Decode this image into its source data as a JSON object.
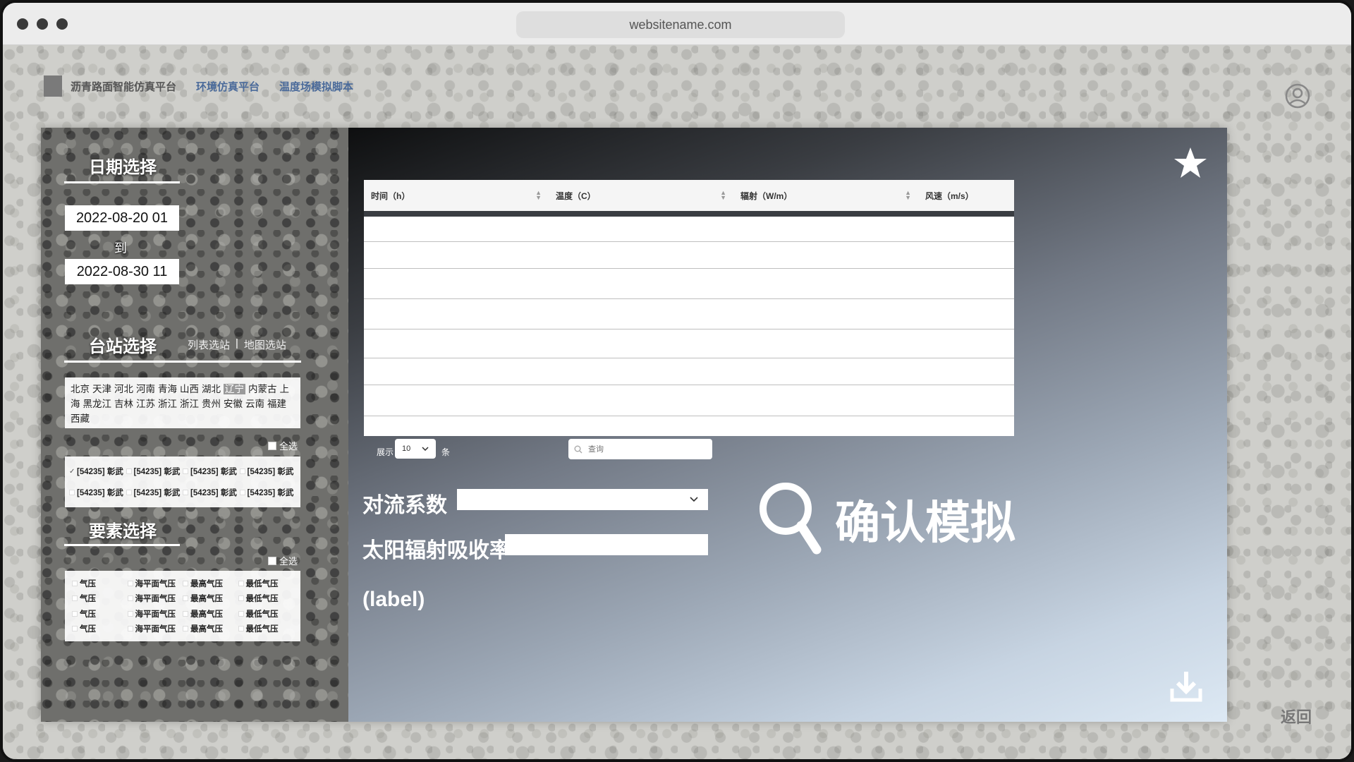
{
  "browser": {
    "url": "websitename.com"
  },
  "nav": {
    "title": "沥青路面智能仿真平台",
    "link1": "环境仿真平台",
    "link2": "温度场模拟脚本"
  },
  "date": {
    "title": "日期选择",
    "start": "2022-08-20 01",
    "to": "到",
    "end": "2022-08-30 11"
  },
  "station": {
    "title": "台站选择",
    "tab_list": "列表选站",
    "tab_map": "地图选站",
    "separator": "|",
    "provinces": [
      "北京",
      "天津",
      "河北",
      "河南",
      "青海",
      "山西",
      "湖北",
      "辽宁",
      "内蒙古",
      "上海",
      "黑龙江",
      "吉林",
      "江苏",
      "浙江",
      "浙江",
      "贵州",
      "安徽",
      "云南",
      "福建",
      "西藏"
    ],
    "selected_province": "辽宁",
    "select_all": "全选",
    "items": [
      "[54235] 彰武",
      "[54235] 彰武",
      "[54235] 彰武",
      "[54235] 彰武",
      "[54235] 彰武",
      "[54235] 彰武",
      "[54235] 彰武",
      "[54235] 彰武"
    ]
  },
  "elements": {
    "title": "要素选择",
    "select_all": "全选",
    "items": [
      "气压",
      "海平面气压",
      "最高气压",
      "最低气压",
      "气压",
      "海平面气压",
      "最高气压",
      "最低气压",
      "气压",
      "海平面气压",
      "最高气压",
      "最低气压",
      "气压",
      "海平面气压",
      "最高气压",
      "最低气压"
    ]
  },
  "table": {
    "headers": [
      "时间（h）",
      "温度（C）",
      "辐射（W/m）",
      "风速（m/s）"
    ],
    "row_count": 7
  },
  "pagination": {
    "show_label": "展示",
    "page_size": "10",
    "per_label": "条",
    "search_placeholder": "查询"
  },
  "form": {
    "convection_label": "对流系数",
    "absorption_label": "太阳辐射吸收率",
    "absorption_sublabel": "(label)"
  },
  "actions": {
    "confirm": "确认模拟",
    "back": "返回"
  },
  "icons": {
    "user": "user-circle-icon",
    "star": "star-icon",
    "search": "search-icon",
    "download": "download-icon",
    "chevron": "chevron-down-icon"
  }
}
